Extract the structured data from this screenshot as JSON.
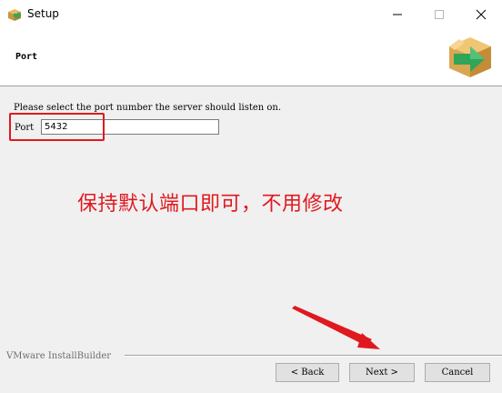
{
  "window": {
    "title": "Setup",
    "app_icon": "installer-icon",
    "controls": [
      "minimize-icon",
      "maximize-icon",
      "close-icon"
    ]
  },
  "header": {
    "title": "Port",
    "logo_icon": "box-arrow-icon"
  },
  "main": {
    "instruction": "Please select the port number the server should listen on.",
    "port_label": "Port",
    "port_value": "5432"
  },
  "annotation": {
    "text": "保持默认端口即可，不用修改",
    "color": "#e0191f"
  },
  "footer": {
    "brand": "VMware InstallBuilder",
    "back_label": "< Back",
    "next_label": "Next >",
    "cancel_label": "Cancel"
  }
}
